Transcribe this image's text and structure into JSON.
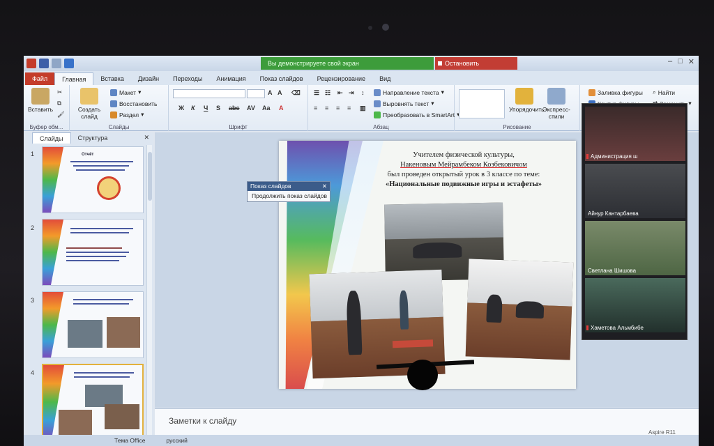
{
  "titlebar": {
    "demo_text": "Вы демонстрируете свой экран",
    "stop_label": "Остановить демонстрацию"
  },
  "tabs": [
    "Файл",
    "Главная",
    "Вставка",
    "Дизайн",
    "Переходы",
    "Анимация",
    "Показ слайдов",
    "Рецензирование",
    "Вид"
  ],
  "ribbon": {
    "clipboard": {
      "paste": "Вставить",
      "label": "Буфер обм..."
    },
    "slides": {
      "create": "Создать слайд",
      "layout": "Макет",
      "reset": "Восстановить",
      "section": "Раздел",
      "label": "Слайды"
    },
    "font": {
      "label": "Шрифт"
    },
    "paragraph": {
      "text_direction": "Направление текста",
      "align_text": "Выровнять текст",
      "smartart": "Преобразовать в SmartArt",
      "label": "Абзац"
    },
    "drawing": {
      "arrange": "Упорядочить",
      "quick_styles": "Экспресс-стили",
      "shape_fill": "Заливка фигуры",
      "shape_outline": "Контур фигуры",
      "label": "Рисование"
    },
    "editing": {
      "find": "Найти",
      "replace": "Заменить"
    }
  },
  "left_panel": {
    "tabs": [
      "Слайды",
      "Структура"
    ],
    "slides": [
      {
        "num": "1",
        "title": "Отчёт"
      },
      {
        "num": "2",
        "title": ""
      },
      {
        "num": "3",
        "title": ""
      },
      {
        "num": "4",
        "title": ""
      }
    ]
  },
  "popup": {
    "title": "Показ слайдов",
    "item": "Продолжить показ слайдов"
  },
  "slide": {
    "line1": "Учителем физической культуры,",
    "line2": "Накеновым Мейрамбеком Козбековичом",
    "line3": "был проведен открытый урок в 3 классе по теме:",
    "line4": "«Национальные подвижные игры и эстафеты»"
  },
  "video": {
    "participants": [
      {
        "name": "Администрация ш"
      },
      {
        "name": "Айнур Кантарбаева"
      },
      {
        "name": "Светлана Шишова"
      },
      {
        "name": "Хаметова Альмбибе"
      }
    ]
  },
  "notes": {
    "placeholder": "Заметки к слайду"
  },
  "status": {
    "theme": "Тема Office",
    "language": "русский"
  },
  "device_brand": "Aspire R11"
}
